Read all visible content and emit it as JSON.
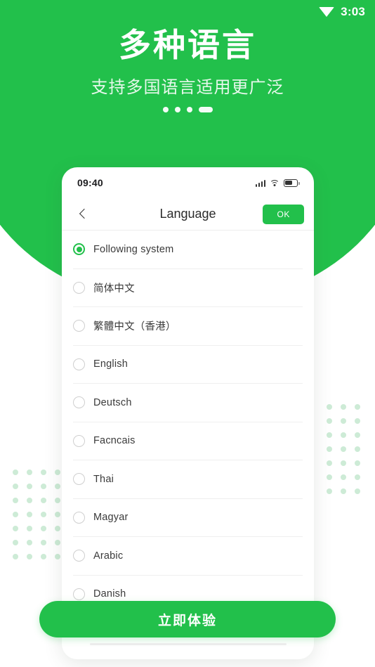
{
  "system_status_bar": {
    "wifi_icon": "wifi-triangle-icon",
    "time": "3:03"
  },
  "hero": {
    "title": "多种语言",
    "subtitle": "支持多国语言适用更广泛",
    "pager": {
      "total": 4,
      "active_index": 3
    }
  },
  "decor": {
    "left_dot_grid": {
      "columns": 4,
      "rows": 7,
      "color": "#cdebd6"
    },
    "right_dot_grid": {
      "columns": 3,
      "rows": 7,
      "color": "#cdebd6"
    }
  },
  "colors": {
    "brand_green": "#22c04b",
    "hero_subtitle": "#e7f8ec",
    "list_divider": "#efefef",
    "radio_unchecked": "#cfcfcf",
    "decor_dot": "#cdebd6"
  },
  "phone": {
    "status_bar": {
      "time": "09:40",
      "signal_icon": "cellular-signal-icon",
      "wifi_icon": "wifi-icon",
      "battery_icon": "battery-icon"
    },
    "nav": {
      "back_icon": "chevron-left-icon",
      "title": "Language",
      "confirm_label": "OK"
    },
    "language_list": [
      {
        "label": "Following system",
        "selected": true
      },
      {
        "label": "简体中文",
        "selected": false
      },
      {
        "label": "繁體中文（香港）",
        "selected": false
      },
      {
        "label": "English",
        "selected": false
      },
      {
        "label": "Deutsch",
        "selected": false
      },
      {
        "label": "Facncais",
        "selected": false
      },
      {
        "label": "Thai",
        "selected": false
      },
      {
        "label": "Magyar",
        "selected": false
      },
      {
        "label": "Arabic",
        "selected": false
      },
      {
        "label": "Danish",
        "selected": false
      }
    ]
  },
  "cta": {
    "label": "立即体验"
  }
}
